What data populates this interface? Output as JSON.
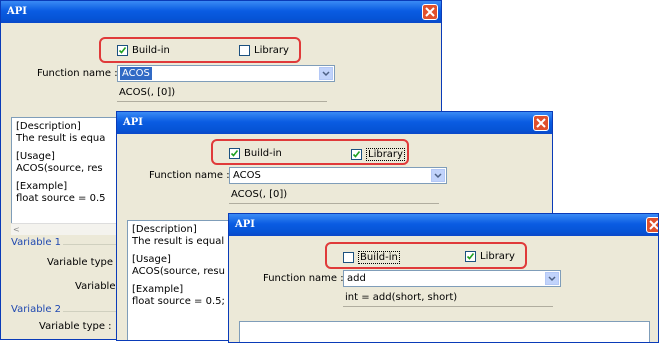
{
  "windows": [
    {
      "title": "API",
      "buildin_label": "Build-in",
      "library_label": "Library",
      "function_name_label": "Function name :",
      "function_value": "ACOS",
      "signature": "ACOS(, [0])",
      "description_lines": [
        "[Description]",
        "   The result is equa",
        "",
        "[Usage]",
        "   ACOS(source, res",
        "",
        "[Example]",
        "   float source = 0.5"
      ],
      "variable1_label": "Variable 1",
      "variable_type_label": "Variable type :",
      "variable_label": "Variable :",
      "variable2_label": "Variable 2",
      "variable_type2_label": "Variable type :"
    },
    {
      "title": "API",
      "buildin_label": "Build-in",
      "library_label": "Library",
      "function_name_label": "Function name :",
      "function_value": "ACOS",
      "signature": "ACOS(, [0])",
      "description_lines": [
        "[Description]",
        "   The result is equal",
        "",
        "[Usage]",
        "   ACOS(source, resu",
        "",
        "[Example]",
        "   float source = 0.5;"
      ]
    },
    {
      "title": "API",
      "buildin_label": "Build-in",
      "library_label": "Library",
      "function_name_label": "Function name :",
      "function_value": "add",
      "signature": "int = add(short, short)"
    }
  ]
}
